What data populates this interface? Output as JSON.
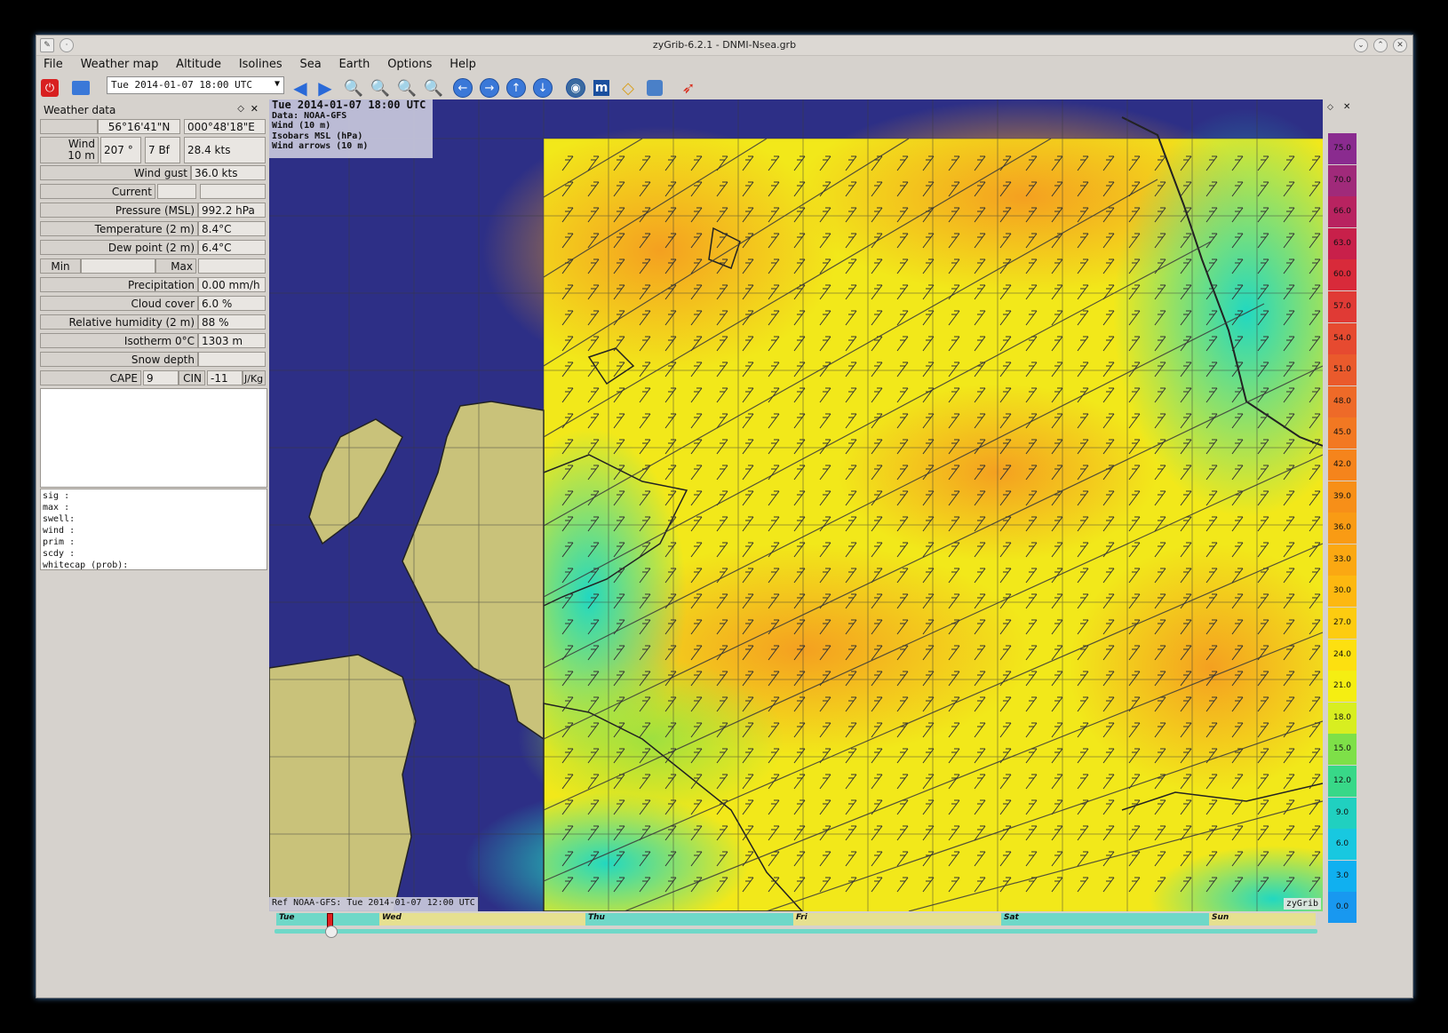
{
  "window": {
    "title": "zyGrib-6.2.1 - DNMI-Nsea.grb"
  },
  "menu": [
    "File",
    "Weather map",
    "Altitude",
    "Isolines",
    "Sea",
    "Earth",
    "Options",
    "Help"
  ],
  "toolbar": {
    "date_select": "Tue 2014-01-07 18:00 UTC"
  },
  "panel": {
    "title": "Weather data",
    "lat": "56°16'41\"N",
    "lon": "000°48'18\"E",
    "wind_label": "Wind\n10 m",
    "wind_dir": "207 °",
    "wind_bf": "7 Bf",
    "wind_kts": "28.4  kts",
    "gust_label": "Wind gust",
    "gust_value": "36.0  kts",
    "current_label": "Current",
    "pressure_label": "Pressure (MSL)",
    "pressure_value": "992.2 hPa",
    "temp_label": "Temperature (2 m)",
    "temp_value": "8.4°C",
    "dew_label": "Dew point (2 m)",
    "dew_value": "6.4°C",
    "min_label": "Min",
    "max_label": "Max",
    "precip_label": "Precipitation",
    "precip_value": "0.00 mm/h",
    "cloud_label": "Cloud cover",
    "cloud_value": "6.0 %",
    "rh_label": "Relative humidity (2 m)",
    "rh_value": "88 %",
    "iso_label": "Isotherm 0°C",
    "iso_value": "1303 m",
    "snow_label": "Snow depth",
    "cape_label": "CAPE",
    "cape_value": "9",
    "cin_label": "CIN",
    "cin_value": "-11",
    "cape_unit": "J/Kg",
    "waves": [
      "sig  :",
      "max  :",
      "swell:",
      "wind :",
      "prim :",
      "scdy :",
      "whitecap (prob):"
    ]
  },
  "map": {
    "info_title": "Tue 2014-01-07 18:00 UTC",
    "info_lines": [
      "Data: NOAA-GFS",
      "Wind (10 m)",
      "Isobars MSL (hPa)",
      "Wind arrows (10 m)"
    ],
    "ref": "Ref NOAA-GFS: Tue 2014-01-07 12:00 UTC",
    "brand": "zyGrib"
  },
  "timeline": {
    "days": [
      "Tue",
      "Wed",
      "Thu",
      "Fri",
      "Sat",
      "Sun"
    ]
  },
  "legend": {
    "values": [
      "75.0",
      "70.0",
      "66.0",
      "63.0",
      "60.0",
      "57.0",
      "54.0",
      "51.0",
      "48.0",
      "45.0",
      "42.0",
      "39.0",
      "36.0",
      "33.0",
      "30.0",
      "27.0",
      "24.0",
      "21.0",
      "18.0",
      "15.0",
      "12.0",
      "9.0",
      "6.0",
      "3.0",
      "0.0"
    ],
    "colors": [
      "#8a2b8f",
      "#a02a7a",
      "#b82360",
      "#c8204a",
      "#d82a3a",
      "#e03a35",
      "#e64a30",
      "#ea5a2c",
      "#ee6a28",
      "#f27822",
      "#f5841c",
      "#f78f18",
      "#f99b14",
      "#fba812",
      "#fdb810",
      "#fdcc10",
      "#fde010",
      "#f5ee12",
      "#d8ee20",
      "#7ee048",
      "#38d888",
      "#20d0c0",
      "#18c8e0",
      "#10b0f0",
      "#1898f0"
    ]
  }
}
